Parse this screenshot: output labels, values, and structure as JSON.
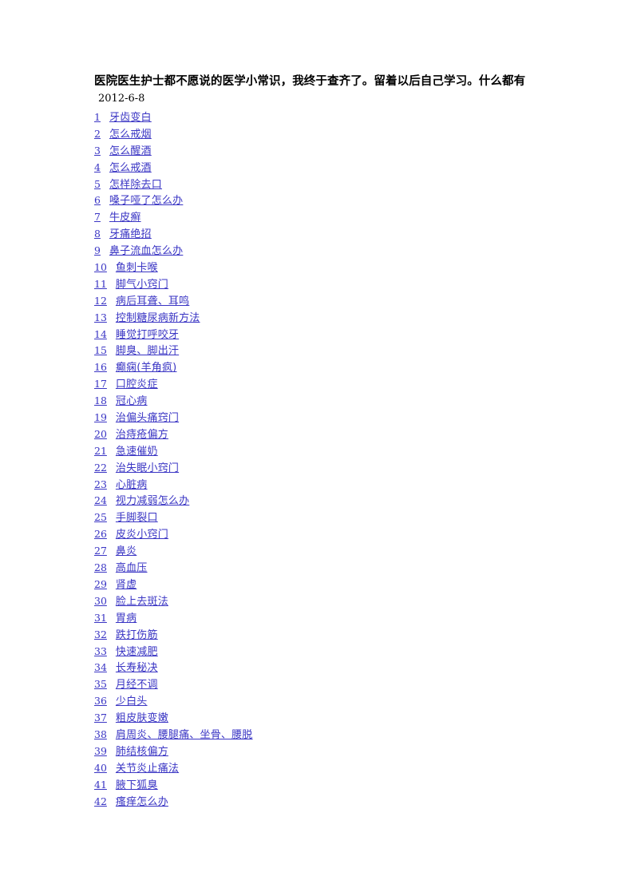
{
  "document": {
    "title": "医院医生护士都不愿说的医学小常识，我终于查齐了。留着以后自己学习。什么都有",
    "date": "2012-6-8",
    "link_color": "#3a35c4",
    "text_color": "#000000",
    "background_color": "#ffffff"
  },
  "toc": {
    "items": [
      {
        "num": "1",
        "label": "牙齿变白"
      },
      {
        "num": "2",
        "label": "怎么戒烟"
      },
      {
        "num": "3",
        "label": "怎么醒酒"
      },
      {
        "num": "4",
        "label": "怎么戒酒"
      },
      {
        "num": "5",
        "label": "怎样除去口"
      },
      {
        "num": "6",
        "label": "嗓子哑了怎么办"
      },
      {
        "num": "7",
        "label": "牛皮癣"
      },
      {
        "num": "8",
        "label": "牙痛绝招"
      },
      {
        "num": "9",
        "label": "鼻子流血怎么办"
      },
      {
        "num": "10",
        "label": "鱼刺卡喉"
      },
      {
        "num": "11",
        "label": "脚气小窍门"
      },
      {
        "num": "12",
        "label": "病后耳聋、耳鸣"
      },
      {
        "num": "13",
        "label": "控制糖尿病新方法"
      },
      {
        "num": "14",
        "label": "睡觉打呼咬牙"
      },
      {
        "num": "15",
        "label": "脚臭、脚出汗"
      },
      {
        "num": "16",
        "label": "癫痫(羊角疯)"
      },
      {
        "num": "17",
        "label": "口腔炎症"
      },
      {
        "num": "18",
        "label": "冠心病"
      },
      {
        "num": "19",
        "label": "治偏头痛窍门"
      },
      {
        "num": "20",
        "label": "治痔疮偏方"
      },
      {
        "num": "21",
        "label": "急速催奶"
      },
      {
        "num": "22",
        "label": "治失眠小窍门"
      },
      {
        "num": "23",
        "label": "心脏病"
      },
      {
        "num": "24",
        "label": "视力减弱怎么办"
      },
      {
        "num": "25",
        "label": "手脚裂口"
      },
      {
        "num": "26",
        "label": "皮炎小窍门"
      },
      {
        "num": "27",
        "label": "鼻炎"
      },
      {
        "num": "28",
        "label": "高血压"
      },
      {
        "num": "29",
        "label": "肾虚"
      },
      {
        "num": "30",
        "label": "脸上去斑法"
      },
      {
        "num": "31",
        "label": "胃病"
      },
      {
        "num": "32",
        "label": "跌打伤筋"
      },
      {
        "num": "33",
        "label": "快速减肥"
      },
      {
        "num": "34",
        "label": "长寿秘决"
      },
      {
        "num": "35",
        "label": "月经不调"
      },
      {
        "num": "36",
        "label": "少白头"
      },
      {
        "num": "37",
        "label": "粗皮肤变嫩"
      },
      {
        "num": "38",
        "label": "肩周炎、腰腿痛、坐骨、腰脱"
      },
      {
        "num": "39",
        "label": "肺结核偏方"
      },
      {
        "num": "40",
        "label": "关节炎止痛法"
      },
      {
        "num": "41",
        "label": "腋下狐臭"
      },
      {
        "num": "42",
        "label": "瘙痒怎么办"
      }
    ]
  }
}
